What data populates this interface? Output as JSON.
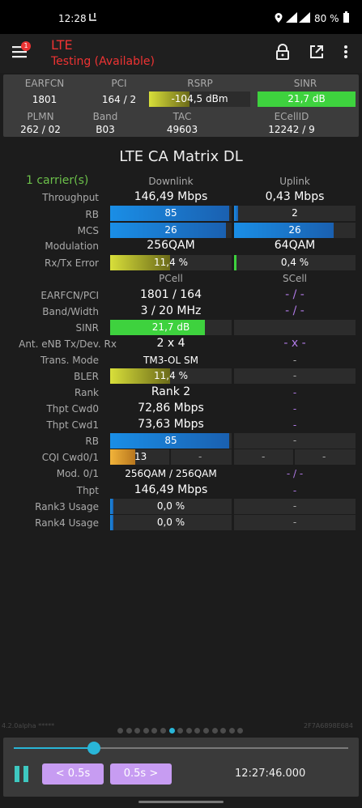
{
  "status_bar": {
    "time": "12:28",
    "battery": "80 %"
  },
  "app_bar": {
    "title": "LTE",
    "subtitle": "Testing (Available)",
    "notification_count": "1"
  },
  "summary": {
    "row1_headers": [
      "EARFCN",
      "PCI",
      "RSRP",
      "SINR"
    ],
    "earfcn": "1801",
    "pci": "164 / 2",
    "rsrp": "-104,5 dBm",
    "sinr": "21,7 dB",
    "rsrp_fill": 0.4,
    "sinr_fill": 1.0,
    "row2_headers": [
      "PLMN",
      "Band",
      "TAC",
      "ECellID"
    ],
    "plmn": "262 / 02",
    "band": "B03",
    "tac": "49603",
    "ecellid": "12242 / 9"
  },
  "matrix": {
    "title": "LTE CA Matrix DL",
    "carriers": "1 carrier(s)",
    "col_downlink": "Downlink",
    "col_uplink": "Uplink",
    "throughput_label": "Throughput",
    "throughput_dl": "146,49 Mbps",
    "throughput_ul": "0,43 Mbps",
    "rb_label": "RB",
    "rb_dl": "85",
    "rb_ul": "2",
    "rb_dl_fill": 0.98,
    "rb_ul_fill": 0.03,
    "mcs_label": "MCS",
    "mcs_dl": "26",
    "mcs_ul": "26",
    "mcs_dl_fill": 0.95,
    "mcs_ul_fill": 0.82,
    "mod_label": "Modulation",
    "mod_dl": "256QAM",
    "mod_ul": "64QAM",
    "rxtx_label": "Rx/Tx Error",
    "rxtx_dl": "11,4 %",
    "rxtx_ul": "0,4 %",
    "rxtx_dl_fill": 0.49,
    "rxtx_ul_fill": 0.02,
    "col_pcell": "PCell",
    "col_scell": "SCell",
    "earfcnpci_label": "EARFCN/PCI",
    "earfcnpci_p": "1801 / 164",
    "earfcnpci_s": "- / -",
    "bandwidth_label": "Band/Width",
    "bandwidth_p": "3 / 20 MHz",
    "bandwidth_s": "- / -",
    "sinr_label": "SINR",
    "sinr_p": "21,7 dB",
    "sinr_s": "",
    "sinr_p_fill": 0.78,
    "ant_label": "Ant. eNB Tx/Dev. Rx",
    "ant_p": "2 x 4",
    "ant_s": "- x -",
    "transmode_label": "Trans. Mode",
    "transmode_p": "TM3-OL SM",
    "transmode_s": "-",
    "bler_label": "BLER",
    "bler_p": "11,4 %",
    "bler_s": "-",
    "bler_p_fill": 0.49,
    "rank_label": "Rank",
    "rank_p": "Rank 2",
    "rank_s": "-",
    "cwd0_label": "Thpt Cwd0",
    "cwd0_p": "72,86 Mbps",
    "cwd0_s": "-",
    "cwd1_label": "Thpt Cwd1",
    "cwd1_p": "73,63 Mbps",
    "cwd1_s": "-",
    "rb2_label": "RB",
    "rb2_p": "85",
    "rb2_s": "-",
    "rb2_p_fill": 0.98,
    "cqi_label": "CQI Cwd0/1",
    "cqi_p0": "13",
    "cqi_p1": "-",
    "cqi_s0": "-",
    "cqi_s1": "-",
    "cqi_p0_fill": 0.43,
    "mod01_label": "Mod. 0/1",
    "mod01_p": "256QAM / 256QAM",
    "mod01_s": "- / -",
    "thpt_label": "Thpt",
    "thpt_p": "146,49 Mbps",
    "thpt_s": "-",
    "rank3_label": "Rank3 Usage",
    "rank3_p": "0,0 %",
    "rank3_s": "-",
    "rank4_label": "Rank4 Usage",
    "rank4_p": "0,0 %",
    "rank4_s": "-"
  },
  "footer": {
    "version": "4.2.0alpha *****",
    "hash": "2F7A6898E684",
    "page_count": 15,
    "active_page": 6
  },
  "playback": {
    "prev_label": "< 0.5s",
    "next_label": "0.5s >",
    "timestamp": "12:27:46.000",
    "progress": 0.24
  },
  "colors": {
    "accent": "#29b6d8",
    "alert": "#e33333",
    "button": "#c79cf2"
  }
}
